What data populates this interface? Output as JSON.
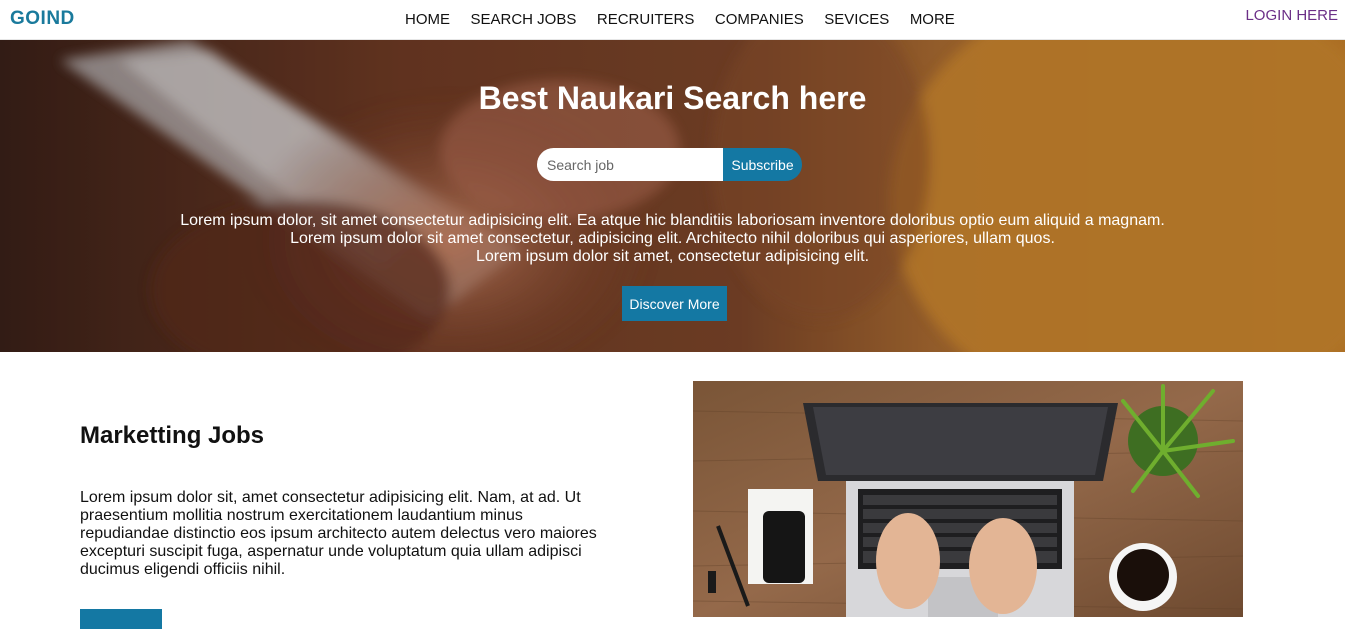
{
  "brand": "GOIND",
  "nav": {
    "items": [
      "HOME",
      "SEARCH JOBS",
      "RECRUITERS",
      "COMPANIES",
      "SEVICES",
      "MORE"
    ],
    "login": "LOGIN HERE"
  },
  "hero": {
    "title": "Best Naukari Search here",
    "search_placeholder": "Search job",
    "subscribe_label": "Subscribe",
    "text_lines": [
      "Lorem ipsum dolor, sit amet consectetur adipisicing elit. Ea atque hic blanditiis laboriosam inventore doloribus optio eum aliquid a magnam.",
      "Lorem ipsum dolor sit amet consectetur, adipisicing elit. Architecto nihil doloribus qui asperiores, ullam quos.",
      "Lorem ipsum dolor sit amet, consectetur adipisicing elit."
    ],
    "discover_label": "Discover More"
  },
  "section": {
    "title": "Marketting Jobs",
    "body": "Lorem ipsum dolor sit, amet consectetur adipisicing elit. Nam, at ad. Ut praesentium mollitia nostrum exercitationem laudantium minus repudiandae distinctio eos ipsum architecto autem delectus vero maiores excepturi suscipit fuga, aspernatur unde voluptatum quia ullam adipisci ducimus eligendi officiis nihil."
  },
  "colors": {
    "brand": "#1a7a9c",
    "accent": "#1478a3",
    "login": "#6b2f87"
  }
}
